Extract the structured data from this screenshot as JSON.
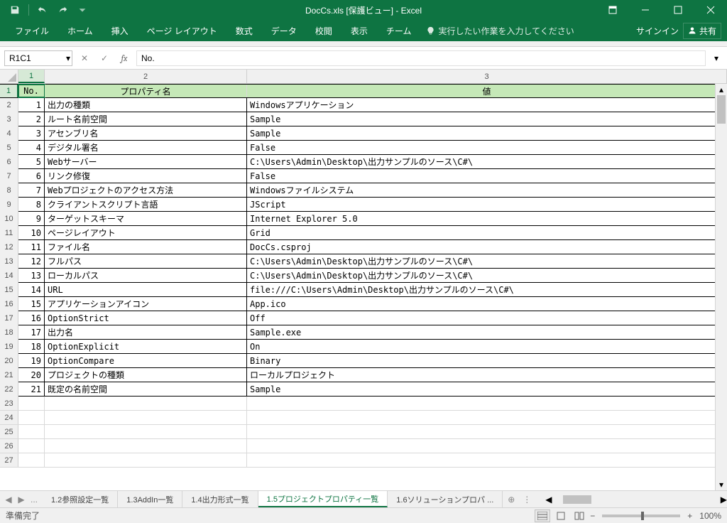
{
  "app": {
    "title": "DocCs.xls  [保護ビュー] - Excel"
  },
  "qat": {
    "save": "save",
    "undo": "undo",
    "redo": "redo"
  },
  "win": {
    "signin": "サインイン",
    "share": "共有"
  },
  "ribbon": {
    "tabs": [
      "ファイル",
      "ホーム",
      "挿入",
      "ページ レイアウト",
      "数式",
      "データ",
      "校閲",
      "表示",
      "チーム"
    ],
    "tellme": "実行したい作業を入力してください"
  },
  "formula": {
    "namebox": "R1C1",
    "value": "No."
  },
  "cols": {
    "1": "1",
    "2": "2",
    "3": "3"
  },
  "headers": {
    "no": "No.",
    "name": "プロパティ名",
    "val": "値"
  },
  "rows": [
    {
      "no": "1",
      "name": "出力の種類",
      "val": "Windowsアプリケーション"
    },
    {
      "no": "2",
      "name": "ルート名前空間",
      "val": "Sample"
    },
    {
      "no": "3",
      "name": "アセンブリ名",
      "val": "Sample"
    },
    {
      "no": "4",
      "name": "デジタル署名",
      "val": "False"
    },
    {
      "no": "5",
      "name": "Webサーバー",
      "val": "C:\\Users\\Admin\\Desktop\\出力サンプルのソース\\C#\\"
    },
    {
      "no": "6",
      "name": "リンク修復",
      "val": "False"
    },
    {
      "no": "7",
      "name": "Webプロジェクトのアクセス方法",
      "val": "Windowsファイルシステム"
    },
    {
      "no": "8",
      "name": "クライアントスクリプト言語",
      "val": "JScript"
    },
    {
      "no": "9",
      "name": "ターゲットスキーマ",
      "val": "Internet Explorer 5.0"
    },
    {
      "no": "10",
      "name": "ページレイアウト",
      "val": "Grid"
    },
    {
      "no": "11",
      "name": "ファイル名",
      "val": "DocCs.csproj"
    },
    {
      "no": "12",
      "name": "フルパス",
      "val": "C:\\Users\\Admin\\Desktop\\出力サンプルのソース\\C#\\"
    },
    {
      "no": "13",
      "name": "ローカルパス",
      "val": "C:\\Users\\Admin\\Desktop\\出力サンプルのソース\\C#\\"
    },
    {
      "no": "14",
      "name": "URL",
      "val": "file:///C:\\Users\\Admin\\Desktop\\出力サンプルのソース\\C#\\"
    },
    {
      "no": "15",
      "name": "アプリケーションアイコン",
      "val": "App.ico"
    },
    {
      "no": "16",
      "name": "OptionStrict",
      "val": "Off"
    },
    {
      "no": "17",
      "name": "出力名",
      "val": "Sample.exe"
    },
    {
      "no": "18",
      "name": "OptionExplicit",
      "val": "On"
    },
    {
      "no": "19",
      "name": "OptionCompare",
      "val": "Binary"
    },
    {
      "no": "20",
      "name": "プロジェクトの種類",
      "val": "ローカルプロジェクト"
    },
    {
      "no": "21",
      "name": "既定の名前空間",
      "val": "Sample"
    }
  ],
  "empty_rows": [
    23,
    24,
    25,
    26,
    27
  ],
  "sheets": {
    "ellipsis": "...",
    "tabs": [
      "1.2参照設定一覧",
      "1.3AddIn一覧",
      "1.4出力形式一覧",
      "1.5プロジェクトプロパティ一覧",
      "1.6ソリューションプロパ ..."
    ],
    "active": 3
  },
  "status": {
    "ready": "準備完了",
    "zoom": "100%"
  }
}
